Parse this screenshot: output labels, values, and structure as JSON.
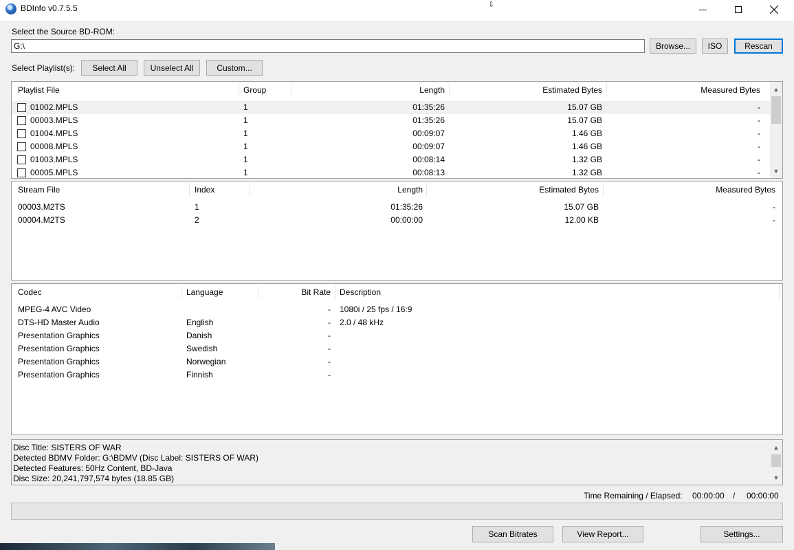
{
  "window": {
    "title": "BDInfo v0.7.5.5",
    "cursor_glyph": "⇩"
  },
  "source": {
    "label": "Select the Source BD-ROM:",
    "path": "G:\\",
    "browse_label": "Browse...",
    "iso_label": "ISO",
    "rescan_label": "Rescan"
  },
  "playlist_controls": {
    "label": "Select Playlist(s):",
    "select_all": "Select All",
    "unselect_all": "Unselect All",
    "custom": "Custom..."
  },
  "playlists": {
    "headers": [
      "Playlist File",
      "Group",
      "Length",
      "Estimated Bytes",
      "Measured Bytes"
    ],
    "rows": [
      {
        "file": "01002.MPLS",
        "group": "1",
        "length": "01:35:26",
        "est": "15.07 GB",
        "meas": "-"
      },
      {
        "file": "00003.MPLS",
        "group": "1",
        "length": "01:35:26",
        "est": "15.07 GB",
        "meas": "-"
      },
      {
        "file": "01004.MPLS",
        "group": "1",
        "length": "00:09:07",
        "est": "1.46 GB",
        "meas": "-"
      },
      {
        "file": "00008.MPLS",
        "group": "1",
        "length": "00:09:07",
        "est": "1.46 GB",
        "meas": "-"
      },
      {
        "file": "01003.MPLS",
        "group": "1",
        "length": "00:08:14",
        "est": "1.32 GB",
        "meas": "-"
      },
      {
        "file": "00005.MPLS",
        "group": "1",
        "length": "00:08:13",
        "est": "1.32 GB",
        "meas": "-"
      }
    ]
  },
  "streams": {
    "headers": [
      "Stream File",
      "Index",
      "Length",
      "Estimated Bytes",
      "Measured Bytes"
    ],
    "rows": [
      {
        "file": "00003.M2TS",
        "index": "1",
        "length": "01:35:26",
        "est": "15.07 GB",
        "meas": "-"
      },
      {
        "file": "00004.M2TS",
        "index": "2",
        "length": "00:00:00",
        "est": "12.00 KB",
        "meas": "-"
      }
    ]
  },
  "codecs": {
    "headers": [
      "Codec",
      "Language",
      "Bit Rate",
      "Description"
    ],
    "rows": [
      {
        "codec": "MPEG-4 AVC Video",
        "language": "",
        "bitrate": "-",
        "desc": "1080i / 25 fps / 16:9"
      },
      {
        "codec": "DTS-HD Master Audio",
        "language": "English",
        "bitrate": "-",
        "desc": "2.0 / 48 kHz"
      },
      {
        "codec": "Presentation Graphics",
        "language": "Danish",
        "bitrate": "-",
        "desc": ""
      },
      {
        "codec": "Presentation Graphics",
        "language": "Swedish",
        "bitrate": "-",
        "desc": ""
      },
      {
        "codec": "Presentation Graphics",
        "language": "Norwegian",
        "bitrate": "-",
        "desc": ""
      },
      {
        "codec": "Presentation Graphics",
        "language": "Finnish",
        "bitrate": "-",
        "desc": ""
      }
    ]
  },
  "info": {
    "lines": [
      "Disc Title: SISTERS OF WAR",
      "Detected BDMV Folder: G:\\BDMV (Disc Label: SISTERS OF WAR)",
      "Detected Features: 50Hz Content, BD-Java",
      "Disc Size: 20,241,797,574 bytes (18.85 GB)"
    ]
  },
  "status": {
    "time_label": "Time Remaining / Elapsed:",
    "remaining": "00:00:00",
    "separator": "/",
    "elapsed": "00:00:00",
    "progress": 0
  },
  "buttons": {
    "scan_bitrates": "Scan Bitrates",
    "view_report": "View Report...",
    "settings": "Settings..."
  },
  "colors": {
    "accent": "#0078d7",
    "selected_row": "#f0f0f0",
    "window_bg": "#f0f0f0"
  }
}
